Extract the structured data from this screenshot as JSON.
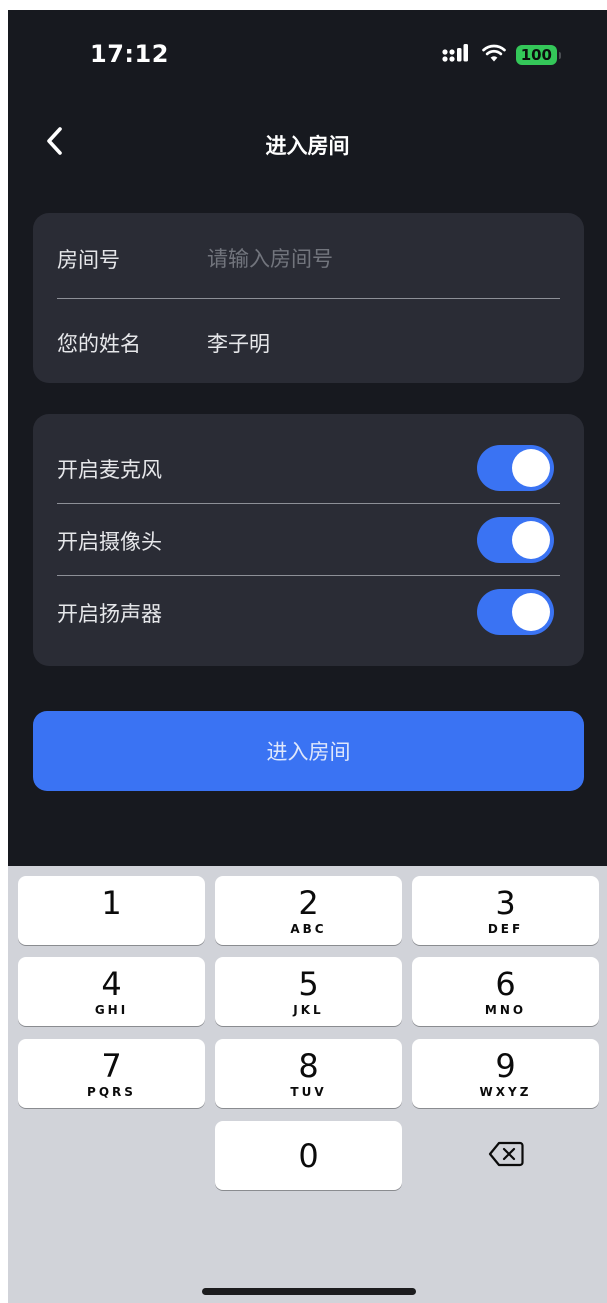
{
  "status_bar": {
    "time": "17:12",
    "battery": "100",
    "icons": [
      "signal-icon",
      "wifi-icon",
      "battery-icon"
    ]
  },
  "nav": {
    "title": "进入房间",
    "back_icon": "chevron-left-icon"
  },
  "form": {
    "room_label": "房间号",
    "room_placeholder": "请输入房间号",
    "room_value": "",
    "name_label": "您的姓名",
    "name_value": "李子明"
  },
  "toggles": [
    {
      "label": "开启麦克风",
      "on": true
    },
    {
      "label": "开启摄像头",
      "on": true
    },
    {
      "label": "开启扬声器",
      "on": true
    }
  ],
  "enter_button": {
    "label": "进入房间"
  },
  "keypad": {
    "keys": [
      {
        "num": "1",
        "letters": ""
      },
      {
        "num": "2",
        "letters": "ABC"
      },
      {
        "num": "3",
        "letters": "DEF"
      },
      {
        "num": "4",
        "letters": "GHI"
      },
      {
        "num": "5",
        "letters": "JKL"
      },
      {
        "num": "6",
        "letters": "MNO"
      },
      {
        "num": "7",
        "letters": "PQRS"
      },
      {
        "num": "8",
        "letters": "TUV"
      },
      {
        "num": "9",
        "letters": "WXYZ"
      },
      {
        "num": "0",
        "letters": ""
      }
    ],
    "delete_icon": "backspace-icon"
  },
  "colors": {
    "background": "#17191f",
    "card": "#2a2c35",
    "accent": "#3a73f3",
    "battery": "#34c759",
    "keyboard": "#d1d3d9"
  }
}
